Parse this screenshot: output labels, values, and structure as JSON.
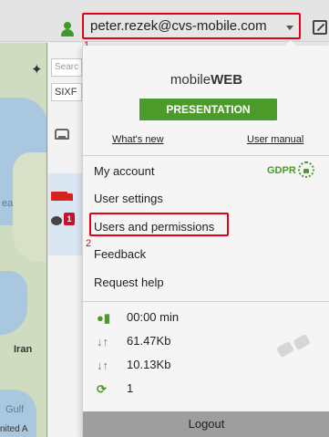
{
  "header": {
    "user_email": "peter.rezek@cvs-mobile.com",
    "annotation_1": "1"
  },
  "left_panel": {
    "search_placeholder": "Searc",
    "vehicle_filter": "SIXF",
    "message_badge_count": "1"
  },
  "map": {
    "labels": [
      "ea",
      "Iran",
      "Gulf",
      "nited A"
    ]
  },
  "user_menu": {
    "brand_prefix": "mobile",
    "brand_suffix": "WEB",
    "presentation_label": "PRESENTATION",
    "whats_new_label": "What's new",
    "user_manual_label": "User manual",
    "gdpr_label": "GDPR",
    "items": [
      {
        "label": "My account"
      },
      {
        "label": "User settings"
      },
      {
        "label": "Users and permissions"
      },
      {
        "label": "Feedback"
      },
      {
        "label": "Request help"
      }
    ],
    "annotation_2": "2",
    "stats": {
      "connection_time": "00:00 min",
      "downloaded": "61.47Kb",
      "uploaded": "10.13Kb",
      "reconnects": "1"
    },
    "logout_label": "Logout"
  },
  "colors": {
    "accent_green": "#4c9a2a",
    "highlight_red": "#e3001b"
  }
}
